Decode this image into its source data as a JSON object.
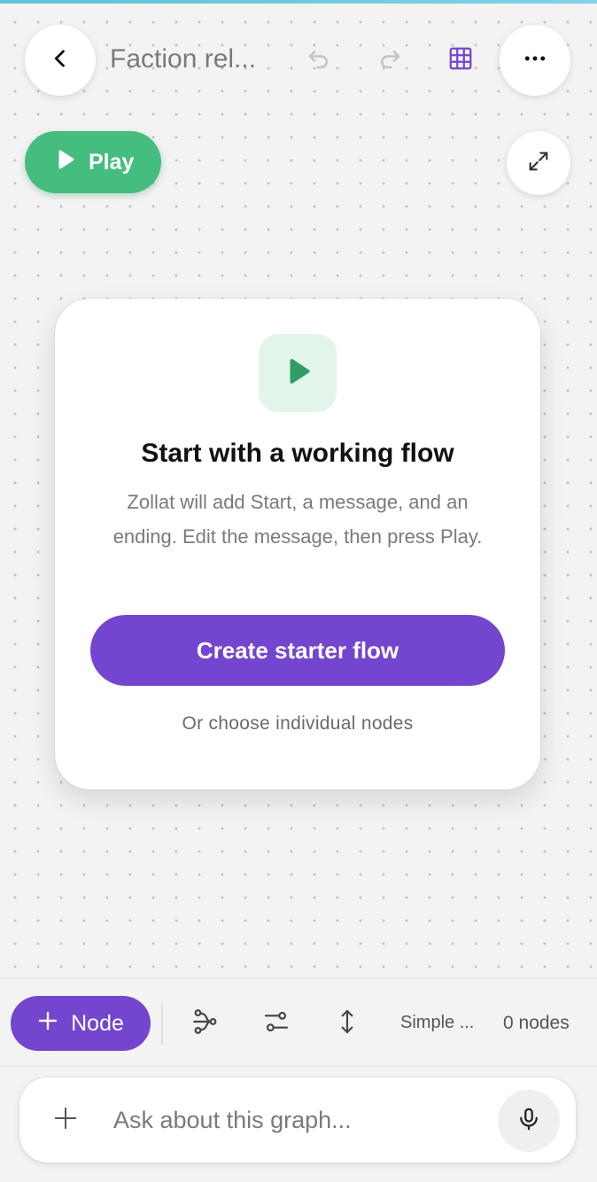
{
  "header": {
    "title": "Faction rel...",
    "back_icon": "chevron-left-icon",
    "undo_icon": "undo-icon",
    "redo_icon": "redo-icon",
    "grid_icon": "grid-icon",
    "more_icon": "more-horizontal-icon"
  },
  "canvas": {
    "play_label": "Play",
    "expand_icon": "expand-icon"
  },
  "starter_card": {
    "icon": "play-icon",
    "title": "Start with a working flow",
    "description": "Zollat will add Start, a message, and an ending. Edit the message, then press Play.",
    "cta_label": "Create starter flow",
    "alt_label": "Or choose individual nodes"
  },
  "toolbar": {
    "add_node_label": "Node",
    "mode_label": "Simple ...",
    "node_count": "0 nodes"
  },
  "ask_bar": {
    "placeholder": "Ask about this graph..."
  },
  "colors": {
    "accent_purple": "#7446cf",
    "play_green": "#45bd7f",
    "card_icon_bg": "#e3f4eb"
  }
}
